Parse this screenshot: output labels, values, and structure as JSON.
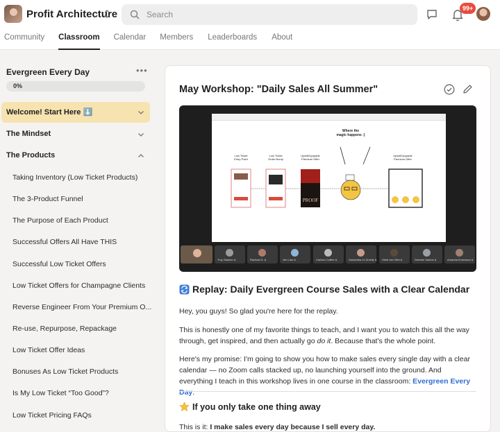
{
  "app": {
    "name": "Profit Architecture",
    "search_placeholder": "Search",
    "notification_count": "99+"
  },
  "nav": {
    "tabs": [
      {
        "label": "Community",
        "active": false
      },
      {
        "label": "Classroom",
        "active": true
      },
      {
        "label": "Calendar",
        "active": false
      },
      {
        "label": "Members",
        "active": false
      },
      {
        "label": "Leaderboards",
        "active": false
      },
      {
        "label": "About",
        "active": false
      }
    ]
  },
  "sidebar": {
    "course_title": "Evergreen Every Day",
    "progress_label": "0%",
    "progress_fraction": 0,
    "modules": [
      {
        "label": "Welcome! Start Here ⬇️",
        "expanded": false,
        "active": true
      },
      {
        "label": "The Mindset",
        "expanded": false,
        "active": false
      },
      {
        "label": "The Products",
        "expanded": true,
        "active": false
      }
    ],
    "lessons": [
      "Taking Inventory (Low Ticket Products)",
      "The 3-Product Funnel",
      "The Purpose of Each Product",
      "Successful Offers All Have THIS",
      "Successful Low Ticket Offers",
      "Low Ticket Offers for Champagne Clients",
      "Reverse Engineer From Your Premium O...",
      "Re-use, Repurpose, Repackage",
      "Low Ticket Offer Ideas",
      "Bonuses As Low Ticket Products",
      "Is My Low Ticket “Too Good”?",
      "Low Ticket Pricing FAQs"
    ]
  },
  "post": {
    "title": "May Workshop: \"Daily Sales All Summer\"",
    "video": {
      "slide_labels": {
        "col1": "Low Ticket\nEntry Point",
        "col2": "Low Ticket\nOrder Bump",
        "col3": "Upsell/Upgrade\nPremium Offer",
        "col4": "Upsell/Upgrade\nPremium Offer",
        "callout": "Where the\nmagic happens :)",
        "proof": "PROOF"
      },
      "participants": [
        "Troy Stanton &",
        "Rachael S. &",
        "Jen Lutz &",
        "Carlson Coffee &",
        "Samantha Jo Smelly &",
        "Heidi van Vliet &",
        "Deedee Santos &",
        "Amanda Ennesson &"
      ]
    },
    "heading": "Replay: Daily Evergreen Course Sales with a Clear Calendar",
    "p1": "Hey, you guys! So glad you're here for the replay.",
    "p2_before": "This is honestly one of my favorite things to teach, and I want you to watch this all the way through, get inspired, and then actually go ",
    "p2_em": "do it",
    "p2_after": ". Because that's the whole point.",
    "p3": "Here's my promise: I'm going to show you how to make sales every single day with a clear calendar — no Zoom calls stacked up, no launching yourself into the ground. And everything I teach in this workshop lives in one course in the classroom: ",
    "p3_link": "Evergreen Every Day",
    "p3_end": ".",
    "subheading": "If you only take one thing away",
    "p4_before": "This is it: ",
    "p4_bold": "I make sales every day because I sell every day.",
    "colors": {
      "accent_link": "#2f6fd1",
      "active_module_bg": "#f6e3b0",
      "badge": "#e84c3d"
    }
  }
}
